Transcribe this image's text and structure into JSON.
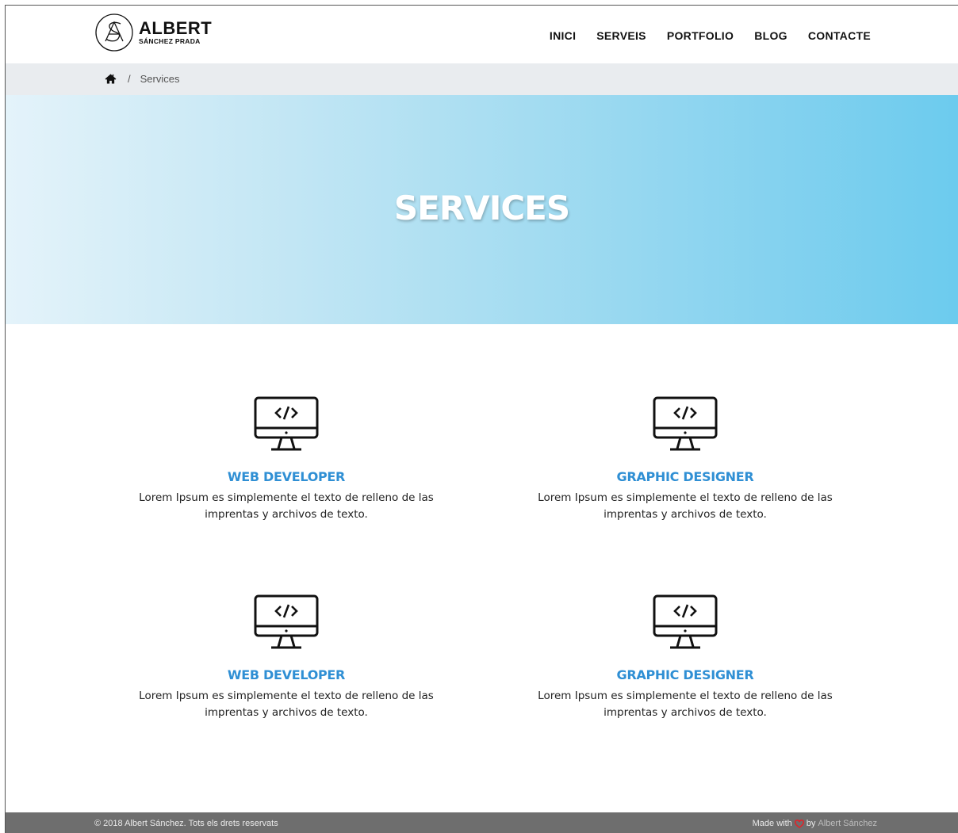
{
  "header": {
    "logo_name": "ALBERT",
    "logo_sub": "SÁNCHEZ PRADA",
    "nav": [
      "INICI",
      "SERVEIS",
      "PORTFOLIO",
      "BLOG",
      "CONTACTE"
    ]
  },
  "breadcrumb": {
    "separator": "/",
    "current": "Services"
  },
  "hero": {
    "title": "SERVICES"
  },
  "services": [
    {
      "title": "WEB DEVELOPER",
      "line1": "Lorem Ipsum es simplemente el texto de relleno de las",
      "line2": "imprentas y archivos de texto."
    },
    {
      "title": "GRAPHIC DESIGNER",
      "line1": "Lorem Ipsum es simplemente el texto de relleno de las",
      "line2": "imprentas y archivos de texto."
    },
    {
      "title": "WEB DEVELOPER",
      "line1": "Lorem Ipsum es simplemente el texto de relleno de las",
      "line2": "imprentas y archivos de texto."
    },
    {
      "title": "GRAPHIC DESIGNER",
      "line1": "Lorem Ipsum es simplemente el texto de relleno de las",
      "line2": "imprentas y archivos de texto."
    }
  ],
  "footer": {
    "copyright": "© 2018 Albert Sánchez. Tots els drets reservats",
    "made_with": "Made with",
    "by": "by",
    "author": "Albert Sánchez"
  },
  "colors": {
    "accent": "#2f8fd4",
    "hero_start": "#e4f3fa",
    "hero_end": "#6ccbee",
    "footer_bg": "#6e6e6e",
    "heart": "#e0242a"
  },
  "icons": {
    "home": "home-icon",
    "service": "monitor-code-icon",
    "heart": "heart-icon"
  }
}
